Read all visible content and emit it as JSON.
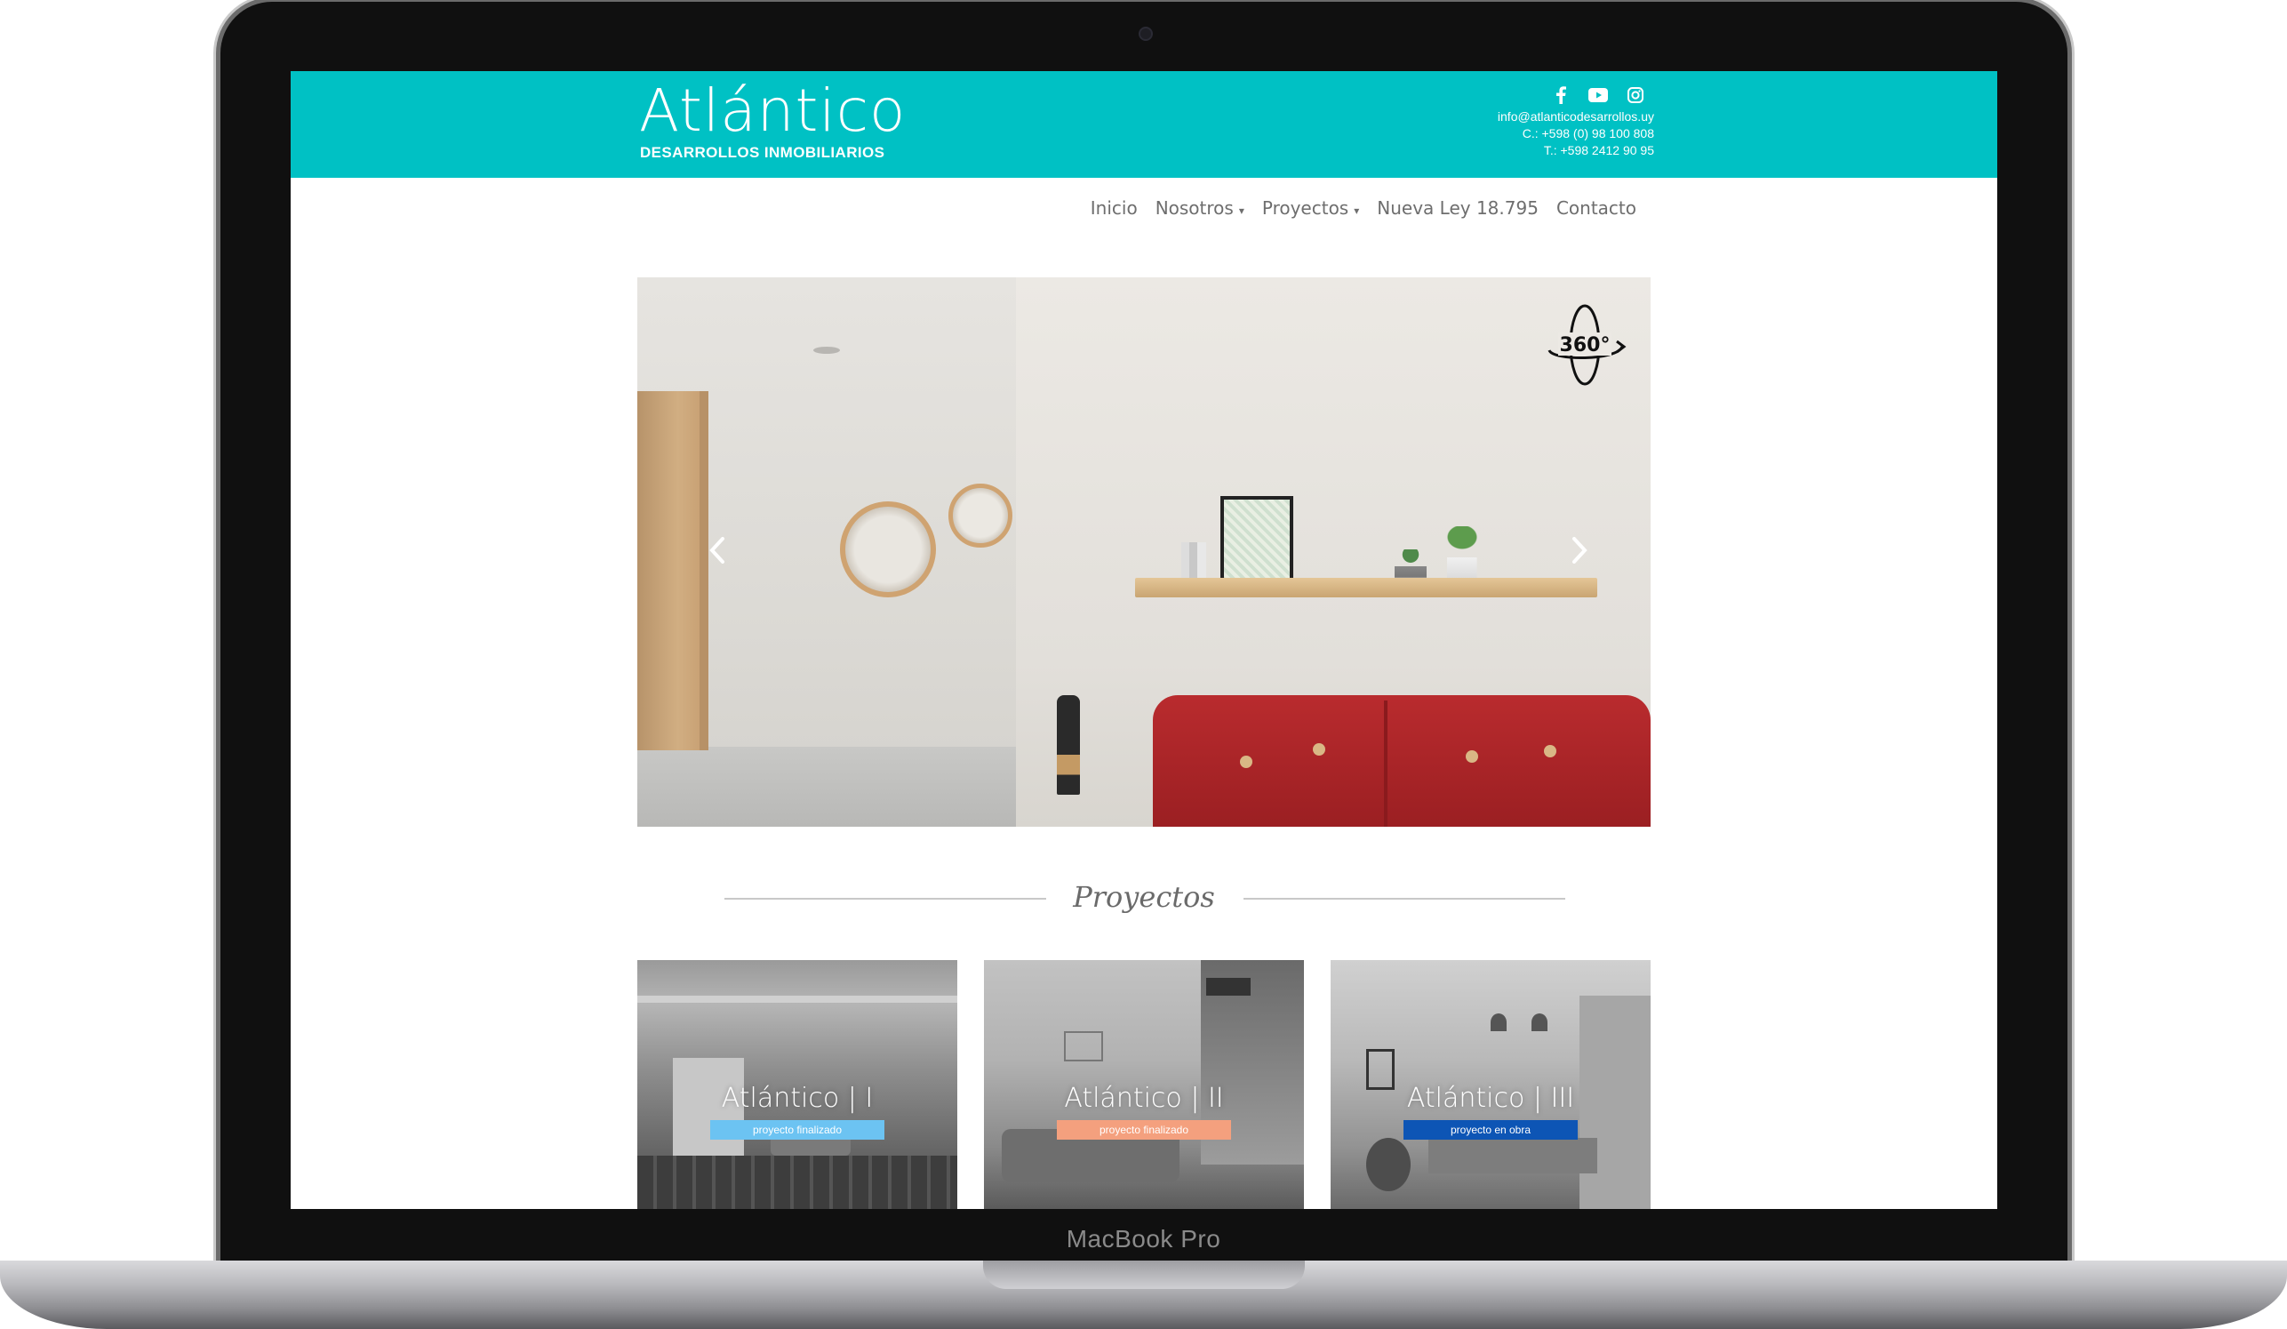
{
  "device": {
    "label": "MacBook Pro"
  },
  "header": {
    "logo_title": "Atlántico",
    "logo_subtitle": "DESARROLLOS INMOBILIARIOS",
    "email": "info@atlanticodesarrollos.uy",
    "cell": "C.: +598 (0) 98 100 808",
    "phone": "T.: +598 2412 90 95",
    "social": [
      "facebook-icon",
      "youtube-icon",
      "instagram-icon"
    ],
    "bg_color": "#00c1c4"
  },
  "nav": {
    "items": [
      {
        "label": "Inicio",
        "dropdown": false
      },
      {
        "label": "Nosotros",
        "dropdown": true
      },
      {
        "label": "Proyectos",
        "dropdown": true
      },
      {
        "label": "Nueva Ley 18.795",
        "dropdown": false
      },
      {
        "label": "Contacto",
        "dropdown": false
      }
    ]
  },
  "slider": {
    "badge": "360°"
  },
  "projects": {
    "heading": "Proyectos",
    "cards": [
      {
        "title": "Atlántico | I",
        "status": "proyecto finalizado",
        "status_color": "#6cc3f2"
      },
      {
        "title": "Atlántico | II",
        "status": "proyecto finalizado",
        "status_color": "#f4a07e"
      },
      {
        "title": "Atlántico | III",
        "status": "proyecto en obra",
        "status_color": "#0d55b5"
      }
    ]
  }
}
